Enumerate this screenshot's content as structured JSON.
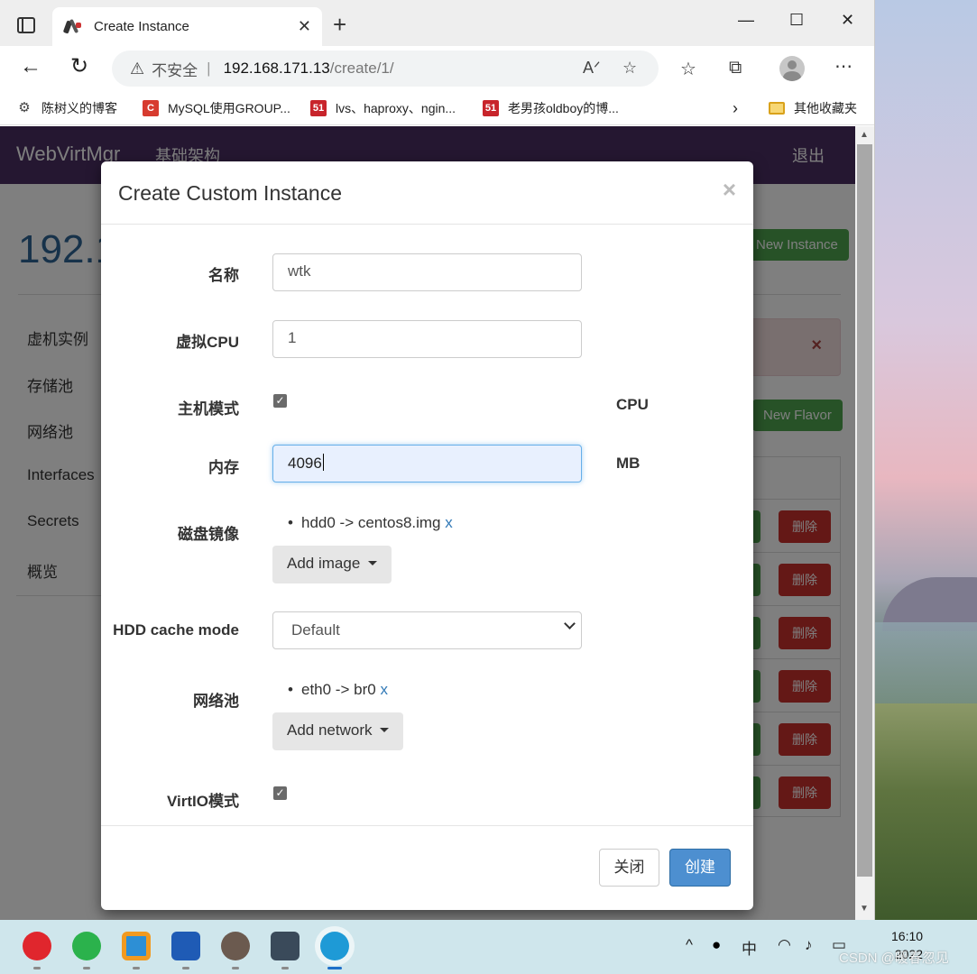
{
  "browser": {
    "tab_title": "Create Instance",
    "omnibox": {
      "security": "不安全",
      "host": "192.168.171.13",
      "path": "/create/1/"
    },
    "bookmarks": [
      {
        "label": "陈树义的博客",
        "color": "#444444",
        "glyph": "⚙"
      },
      {
        "label": "MySQL使用GROUP...",
        "color": "#d73b2f",
        "glyph": "C"
      },
      {
        "label": "lvs、haproxy、ngin...",
        "color": "#c8242b",
        "glyph": "51"
      },
      {
        "label": "老男孩oldboy的博...",
        "color": "#c8242b",
        "glyph": "51"
      }
    ],
    "other_bookmarks": "其他收藏夹"
  },
  "page": {
    "brand": "WebVirtMgr",
    "nav_link": "基础架构",
    "logout": "退出",
    "host_title": "192.1",
    "sidebar": [
      "虚机实例",
      "存储池",
      "网络池",
      "Interfaces",
      "Secrets",
      "概览"
    ],
    "new_instance": "New Instance",
    "new_flavor": "New Flavor",
    "delete_label": "删除",
    "alert_close": "×"
  },
  "modal": {
    "title": "Create Custom Instance",
    "close_x": "×",
    "fields": {
      "name_label": "名称",
      "name_value": "wtk",
      "vcpu_label": "虚拟CPU",
      "vcpu_value": "1",
      "host_mode_label": "主机模式",
      "host_mode_suffix": "CPU",
      "memory_label": "内存",
      "memory_value": "4096",
      "memory_suffix": "MB",
      "disk_label": "磁盘镜像",
      "disk_item": "hdd0 -> centos8.img",
      "remove_x": "x",
      "add_image": "Add image",
      "cache_label": "HDD cache mode",
      "cache_value": "Default",
      "network_label": "网络池",
      "network_item": "eth0 -> br0",
      "add_network": "Add network",
      "virtio_label": "VirtIO模式"
    },
    "footer": {
      "close": "关闭",
      "create": "创建"
    }
  },
  "taskbar": {
    "tray_ime": "中",
    "time": "16:10",
    "date": "2022"
  },
  "watermark": "CSDN @暖春忽见"
}
